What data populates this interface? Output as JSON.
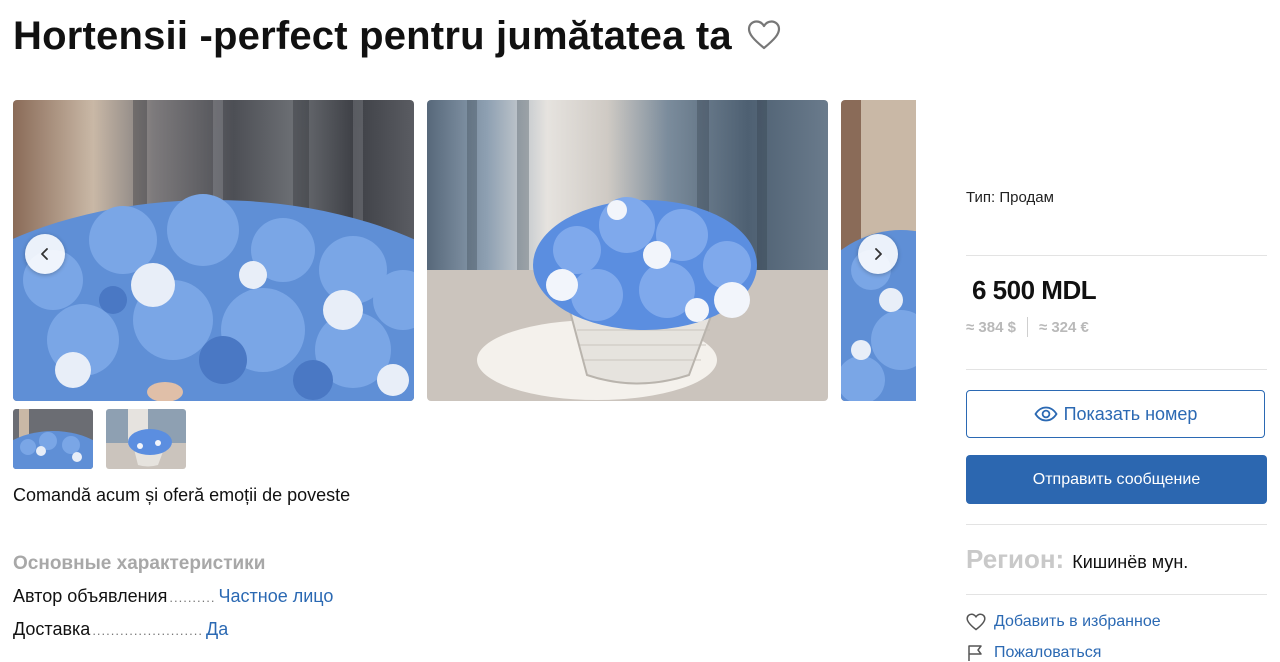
{
  "listing": {
    "title": "Hortensii -perfect pentru jumătatea ta",
    "description": "Comandă acum și oferă emoții de poveste"
  },
  "characteristics": {
    "heading": "Основные характеристики",
    "rows": [
      {
        "key": "Автор объявления",
        "dots": "..........",
        "value": "Частное лицо"
      },
      {
        "key": "Доставка",
        "dots": "........................",
        "value": "Да"
      }
    ]
  },
  "sidebar": {
    "type": "Тип: Продам",
    "price": "6 500 MDL",
    "price_usd": "≈ 384 $",
    "price_eur": "≈ 324 €",
    "show_number_label": "Показать номер",
    "send_message_label": "Отправить сообщение",
    "region_label": "Регион:",
    "region_value": "Кишинёв мун.",
    "add_favorite_label": "Добавить в избранное",
    "complain_label": "Пожаловаться"
  },
  "colors": {
    "accent": "#2b69b3",
    "button_bg": "#2c67b0",
    "muted": "#b9b9b9"
  },
  "icons": {
    "favorite": "heart-outline-icon",
    "prev": "chevron-left-icon",
    "next": "chevron-right-icon",
    "eye": "eye-icon",
    "flag": "flag-icon"
  }
}
